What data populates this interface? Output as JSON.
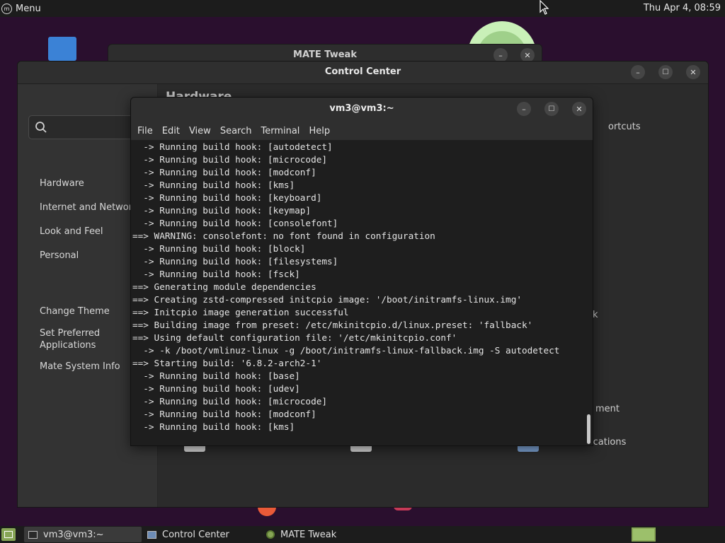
{
  "top_panel": {
    "menu_label": "Menu",
    "clock": "Thu Apr  4, 08:59"
  },
  "tweak_window": {
    "title": "MATE Tweak",
    "minimize_glyph": "–",
    "close_glyph": "✕"
  },
  "control_center": {
    "title": "Control Center",
    "section_title": "Hardware",
    "minimize_glyph": "–",
    "maximize_glyph": "☐",
    "close_glyph": "✕",
    "nav": {
      "hardware": "Hardware",
      "internet": "Internet and Network",
      "look": "Look and Feel",
      "personal": "Personal",
      "change_theme": "Change Theme",
      "set_preferred": "Set Preferred Applications",
      "system_info": "Mate System Info"
    },
    "edge_texts": {
      "shortcuts": "ortcuts",
      "k": "k",
      "ment": "ment",
      "ications": "ications"
    }
  },
  "terminal": {
    "title": "vm3@vm3:~",
    "minimize_glyph": "–",
    "maximize_glyph": "☐",
    "close_glyph": "✕",
    "menus": [
      "File",
      "Edit",
      "View",
      "Search",
      "Terminal",
      "Help"
    ],
    "lines": [
      "  -> Running build hook: [autodetect]",
      "  -> Running build hook: [microcode]",
      "  -> Running build hook: [modconf]",
      "  -> Running build hook: [kms]",
      "  -> Running build hook: [keyboard]",
      "  -> Running build hook: [keymap]",
      "  -> Running build hook: [consolefont]",
      "==> WARNING: consolefont: no font found in configuration",
      "  -> Running build hook: [block]",
      "  -> Running build hook: [filesystems]",
      "  -> Running build hook: [fsck]",
      "==> Generating module dependencies",
      "==> Creating zstd-compressed initcpio image: '/boot/initramfs-linux.img'",
      "==> Initcpio image generation successful",
      "==> Building image from preset: /etc/mkinitcpio.d/linux.preset: 'fallback'",
      "==> Using default configuration file: '/etc/mkinitcpio.conf'",
      "  -> -k /boot/vmlinuz-linux -g /boot/initramfs-linux-fallback.img -S autodetect",
      "==> Starting build: '6.8.2-arch2-1'",
      "  -> Running build hook: [base]",
      "  -> Running build hook: [udev]",
      "  -> Running build hook: [microcode]",
      "  -> Running build hook: [modconf]",
      "  -> Running build hook: [kms]"
    ]
  },
  "taskbar": {
    "tasks": [
      {
        "label": "vm3@vm3:~"
      },
      {
        "label": "Control Center"
      },
      {
        "label": "MATE Tweak"
      }
    ]
  }
}
